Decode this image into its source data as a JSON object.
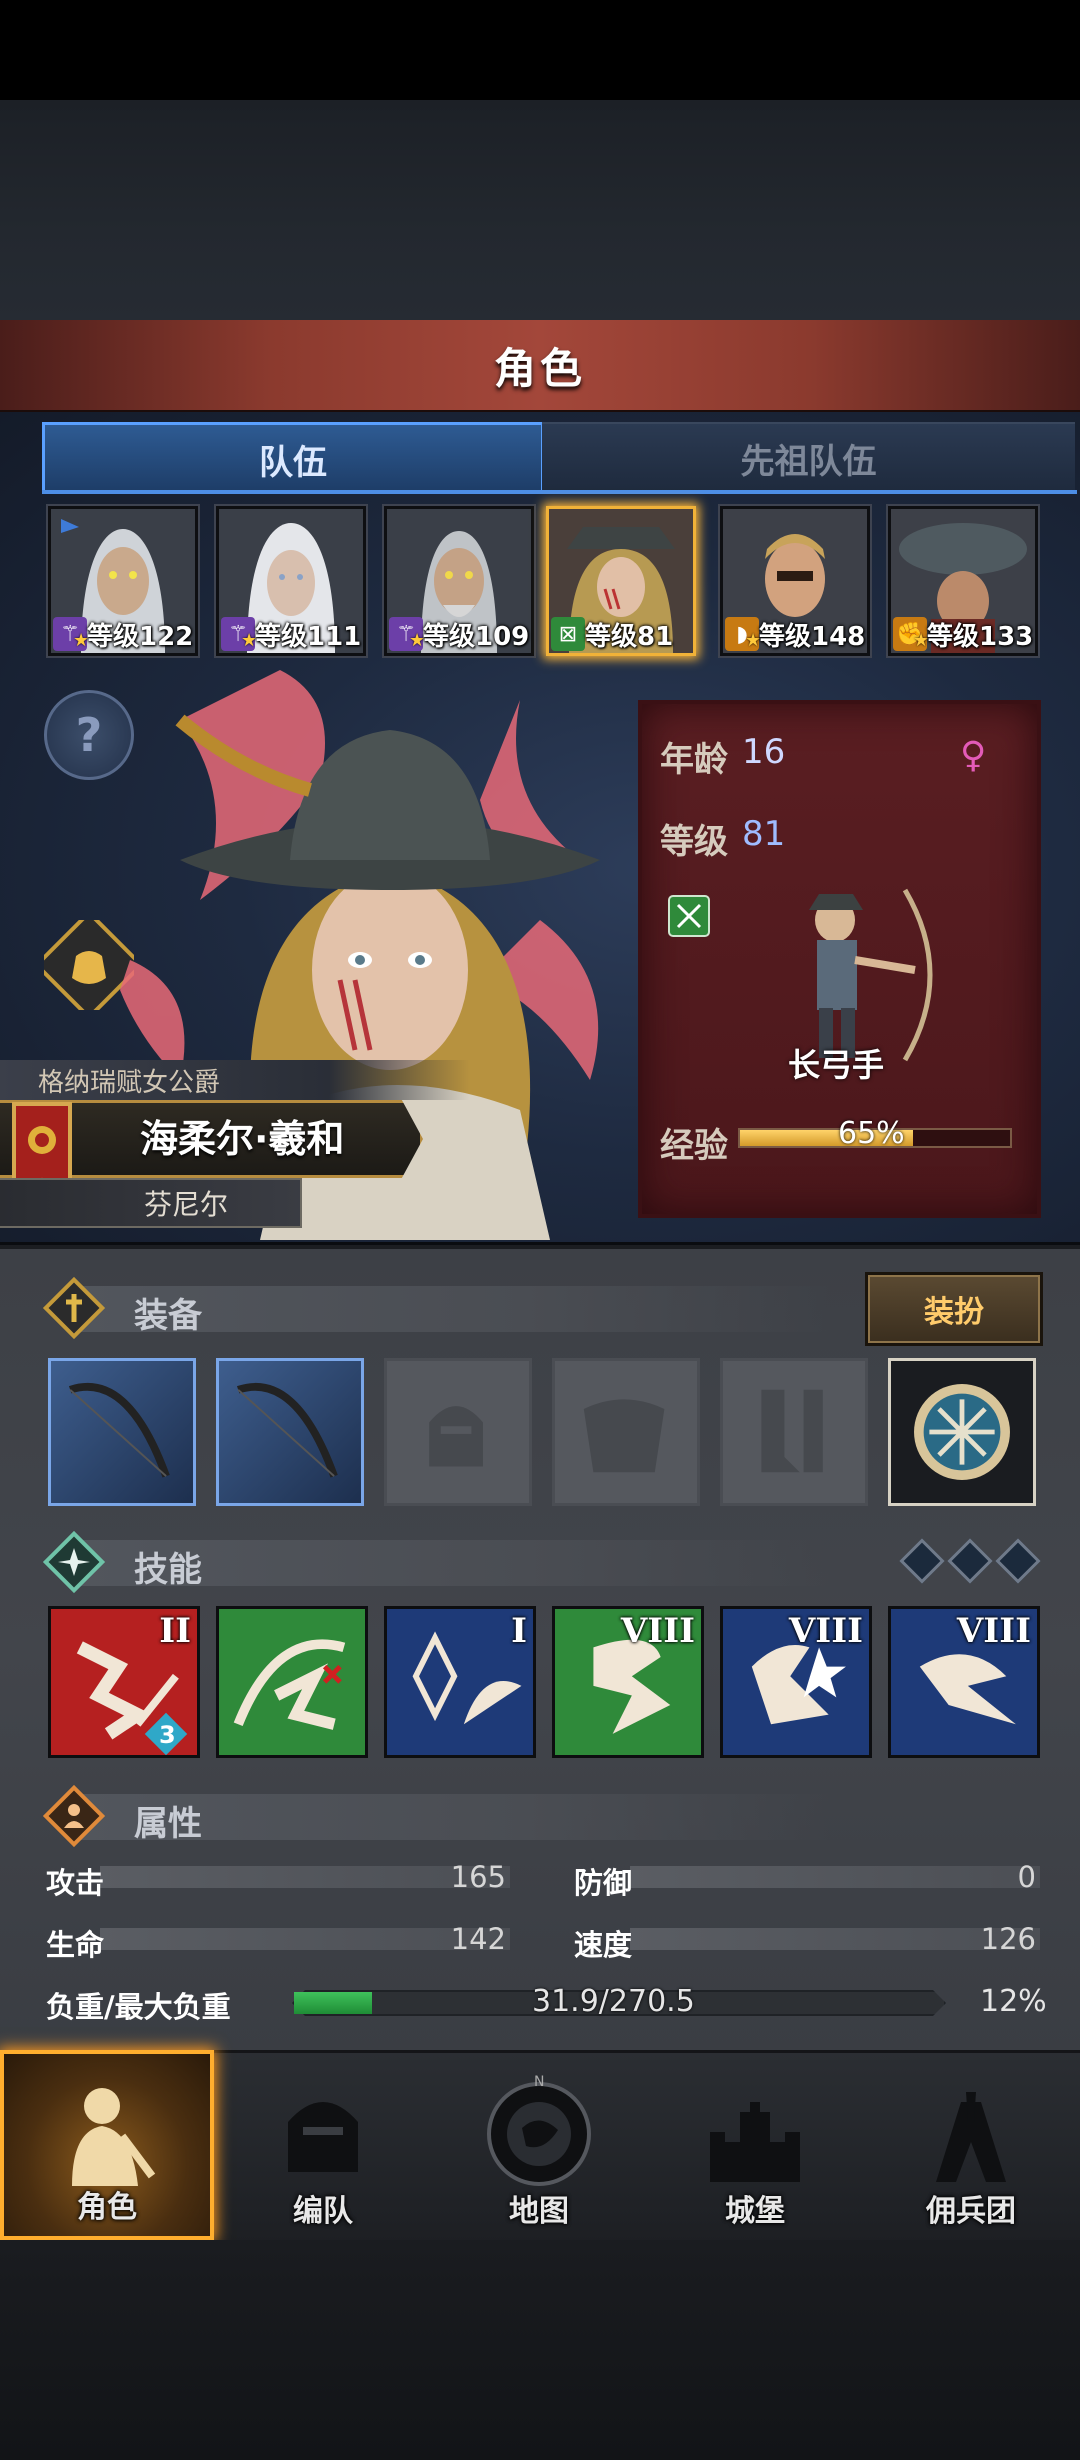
{
  "title": "角色",
  "tabs": {
    "team": "队伍",
    "ancestor": "先祖队伍"
  },
  "heroes": [
    {
      "level": "等级122",
      "badge_color": "#6c3fa8",
      "badge_icon": "staff-icon",
      "selected": false
    },
    {
      "level": "等级111",
      "badge_color": "#6c3fa8",
      "badge_icon": "staff-icon",
      "selected": false
    },
    {
      "level": "等级109",
      "badge_color": "#6c3fa8",
      "badge_icon": "staff-icon",
      "selected": false
    },
    {
      "level": "等级81",
      "badge_color": "#2f8a3a",
      "badge_icon": "bow-icon",
      "selected": true
    },
    {
      "level": "等级148",
      "badge_color": "#c77a12",
      "badge_icon": "shield-icon",
      "selected": false
    },
    {
      "level": "等级133",
      "badge_color": "#c77a12",
      "badge_icon": "fist-icon",
      "selected": false
    }
  ],
  "character": {
    "title": "格纳瑞赋女公爵",
    "name": "海柔尔·羲和",
    "region": "芬尼尔",
    "age_label": "年龄",
    "age": "16",
    "level_label": "等级",
    "level": "81",
    "gender_icon": "female-icon",
    "class_name": "长弓手",
    "exp_label": "经验",
    "exp_pct_text": "65%",
    "exp_fraction": 0.65
  },
  "equipment": {
    "title": "装备",
    "dress_button": "装扮",
    "slots": [
      "bow",
      "bow",
      "helmet-empty",
      "armor-empty",
      "boots-empty",
      "accessory"
    ]
  },
  "skills": {
    "title": "技能",
    "items": [
      {
        "level": "II",
        "badge": "3",
        "bg": "#b52020",
        "icon": "slash-icon"
      },
      {
        "level": "",
        "badge": "",
        "bg": "#2f8a3a",
        "icon": "sweep-icon"
      },
      {
        "level": "I",
        "badge": "",
        "bg": "#1e3a78",
        "icon": "crystal-icon"
      },
      {
        "level": "VIII",
        "badge": "",
        "bg": "#2f8a3a",
        "icon": "wing-icon"
      },
      {
        "level": "VIII",
        "badge": "",
        "bg": "#1e3a78",
        "icon": "burst-icon"
      },
      {
        "level": "VIII",
        "badge": "",
        "bg": "#1e3a78",
        "icon": "wing-icon"
      }
    ]
  },
  "attributes": {
    "title": "属性",
    "attack_label": "攻击",
    "attack": "165",
    "defense_label": "防御",
    "defense": "0",
    "hp_label": "生命",
    "hp": "142",
    "speed_label": "速度",
    "speed": "126",
    "load_label": "负重/最大负重",
    "load_text": "31.9/270.5",
    "load_pct": "12%",
    "load_fraction": 0.12
  },
  "nav": [
    {
      "label": "角色",
      "icon": "knight-icon",
      "active": true
    },
    {
      "label": "编队",
      "icon": "helmet-icon",
      "active": false
    },
    {
      "label": "地图",
      "icon": "compass-map-icon",
      "active": false
    },
    {
      "label": "城堡",
      "icon": "castle-icon",
      "active": false
    },
    {
      "label": "佣兵团",
      "icon": "mercenary-icon",
      "active": false
    }
  ],
  "colors": {
    "accent_blue": "#5aa0ff",
    "gold": "#ffae2e",
    "exp_bar": "#e0a83a",
    "load_bar": "#3fc25b"
  }
}
